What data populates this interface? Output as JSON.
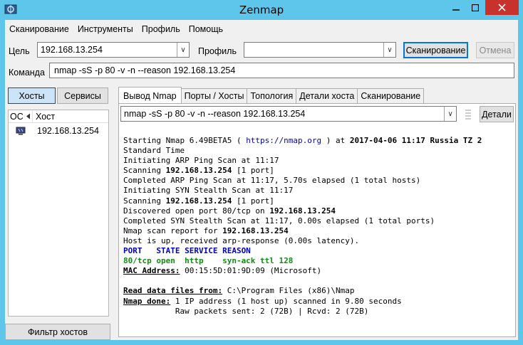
{
  "window": {
    "title": "Zenmap"
  },
  "menu": [
    "Сканирование",
    "Инструменты",
    "Профиль",
    "Помощь"
  ],
  "target": {
    "label": "Цель",
    "value": "192.168.13.254"
  },
  "profile": {
    "label": "Профиль",
    "value": ""
  },
  "buttons": {
    "scan": "Сканирование",
    "cancel": "Отмена",
    "details": "Детали",
    "filter": "Фильтр хостов"
  },
  "command": {
    "label": "Команда",
    "value": "nmap -sS -p 80 -v -n --reason 192.168.13.254"
  },
  "view_toggle": {
    "hosts": "Хосты",
    "services": "Сервисы"
  },
  "host_list": {
    "columns": {
      "os": "ОС",
      "host": "Хост"
    },
    "rows": [
      {
        "host": "192.168.13.254"
      }
    ]
  },
  "tabs": [
    "Вывод Nmap",
    "Порты / Хосты",
    "Топология",
    "Детали хоста",
    "Сканирование"
  ],
  "output_select": "nmap -sS -p 80 -v -n --reason 192.168.13.254",
  "output": {
    "l1a": "Starting Nmap 6.49BETA5 ( ",
    "l1_url": "https://nmap.org",
    "l1b": " ) at ",
    "l1_date": "2017-04-06 11:17 Russia TZ 2",
    "l2": "Standard Time",
    "l3": "Initiating ARP Ping Scan at 11:17",
    "l4a": "Scanning ",
    "l4_ip": "192.168.13.254",
    "l4b": " [1 port]",
    "l5": "Completed ARP Ping Scan at 11:17, 5.70s elapsed (1 total hosts)",
    "l6": "Initiating SYN Stealth Scan at 11:17",
    "l7a": "Scanning ",
    "l7_ip": "192.168.13.254",
    "l7b": " [1 port]",
    "l8a": "Discovered open port 80/tcp on ",
    "l8_ip": "192.168.13.254",
    "l9": "Completed SYN Stealth Scan at 11:17, 0.00s elapsed (1 total ports)",
    "l10a": "Nmap scan report for ",
    "l10_ip": "192.168.13.254",
    "l11": "Host is up, received arp-response (0.00s latency).",
    "l12": "PORT   STATE SERVICE REASON",
    "l13": "80/tcp open  http    syn-ack ttl 128",
    "l14a": "MAC Address:",
    "l14b": " 00:15:5D:01:9D:09 (Microsoft)",
    "l16a": "Read data files from:",
    "l16b": " C:\\Program Files (x86)\\Nmap",
    "l17a": "Nmap done:",
    "l17b": " 1 IP address (1 host up) scanned in 9.80 seconds",
    "l18": "           Raw packets sent: 2 (72B) | Rcvd: 2 (72B)"
  }
}
